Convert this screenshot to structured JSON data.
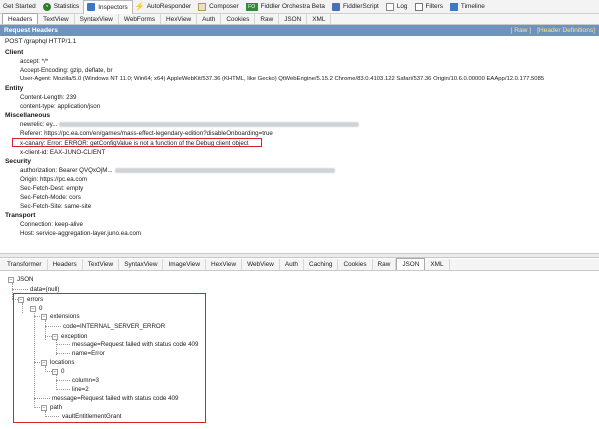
{
  "toolbar": {
    "tabs": [
      {
        "label": "Get Started",
        "icon": "none"
      },
      {
        "label": "Statistics",
        "icon": "statistics-icon"
      },
      {
        "label": "Inspectors",
        "icon": "inspectors-icon"
      },
      {
        "label": "AutoResponder",
        "icon": "autoresponder-icon"
      },
      {
        "label": "Composer",
        "icon": "composer-icon"
      },
      {
        "label": "Fiddler Orchestra Beta",
        "icon": "fiddler-orchestra-icon",
        "icon_text": "FO"
      },
      {
        "label": "FiddlerScript",
        "icon": "fiddlerscript-icon"
      },
      {
        "label": "Log",
        "icon": "log-icon"
      },
      {
        "label": "Filters",
        "icon": "filters-icon"
      },
      {
        "label": "Timeline",
        "icon": "timeline-icon"
      }
    ]
  },
  "request_tabs": [
    "Headers",
    "TextView",
    "SyntaxView",
    "WebForms",
    "HexView",
    "Auth",
    "Cookies",
    "Raw",
    "JSON",
    "XML"
  ],
  "request_headers": {
    "title": "Request Headers",
    "raw_link": "[ Raw ]",
    "defs_link": "[Header Definitions]",
    "request_line": "POST /graphql HTTP/1.1",
    "groups": {
      "client": {
        "label": "Client",
        "accept": "accept: */*",
        "accept_encoding": "Accept-Encoding: gzip, deflate, br",
        "user_agent": "User-Agent: Mozilla/5.0 (Windows NT 11.0; Win64; x64) AppleWebKit/537.36 (KHTML, like Gecko) QtWebEngine/5.15.2 Chrome/83.0.4103.122 Safari/537.36 Origin/10.6.0.00000 EAApp/12.0.177.5085"
      },
      "entity": {
        "label": "Entity",
        "content_length": "Content-Length: 239",
        "content_type": "content-type: application/json"
      },
      "misc": {
        "label": "Miscellaneous",
        "newrelic": "newrelic: ey...",
        "referer": "Referer: https://pc.ea.com/en/games/mass-effect-legendary-edition?disableOnboarding=true",
        "x_canary": "x-canary: Error: ERROR: getConfigValue is not a function of the Debug client object",
        "x_client_id": "x-client-id: EAX-JUNO-CLIENT"
      },
      "security": {
        "label": "Security",
        "authorization": "authorization: Bearer QVQxOjM...",
        "origin": "Origin: https://pc.ea.com",
        "sec_dest": "Sec-Fetch-Dest: empty",
        "sec_mode": "Sec-Fetch-Mode: cors",
        "sec_site": "Sec-Fetch-Site: same-site"
      },
      "transport": {
        "label": "Transport",
        "connection": "Connection: keep-alive",
        "host": "Host: service-aggregation-layer.juno.ea.com"
      }
    }
  },
  "response_tabs": [
    "Transformer",
    "Headers",
    "TextView",
    "SyntaxView",
    "ImageView",
    "HexView",
    "WebView",
    "Auth",
    "Caching",
    "Cookies",
    "Raw",
    "JSON",
    "XML"
  ],
  "json_tree": {
    "root": "JSON",
    "data": "data=(null)",
    "errors": "errors",
    "idx0": "0",
    "extensions": "extensions",
    "code": "code=INTERNAL_SERVER_ERROR",
    "exception": "exception",
    "exc_message": "message=Request failed with status code 409",
    "exc_name": "name=Error",
    "locations": "locations",
    "loc0": "0",
    "column": "column=3",
    "line": "line=2",
    "message": "message=Request failed with status code 409",
    "path": "path",
    "path_val": "vaultEntitlementGrant"
  },
  "colors": {
    "header_bar": "#6f92be",
    "highlight_box": "#d3232b",
    "link": "#ffe38a"
  }
}
